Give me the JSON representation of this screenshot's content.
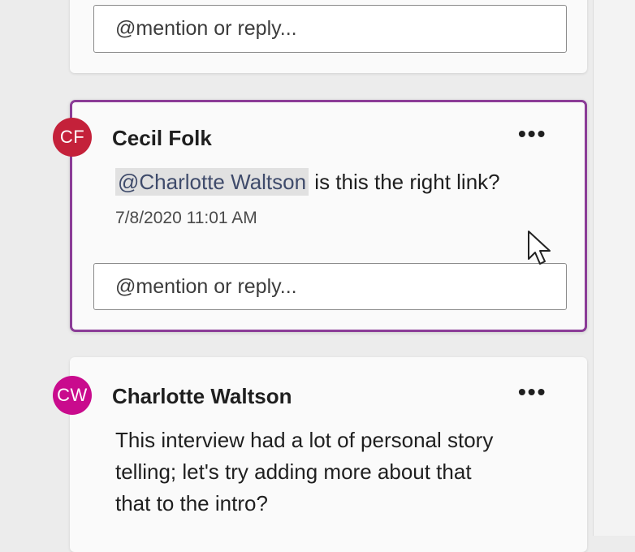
{
  "top_comment": {
    "reply_placeholder": "@mention or reply..."
  },
  "active_comment": {
    "avatar_initials": "CF",
    "avatar_color": "#c4213a",
    "author": "Cecil Folk",
    "more_label": "•••",
    "mention": "@Charlotte Waltson",
    "text": " is this the right link?",
    "timestamp": "7/8/2020 11:01 AM",
    "reply_placeholder": "@mention or reply...",
    "highlight_color": "#8b3c97"
  },
  "bottom_comment": {
    "avatar_initials": "CW",
    "avatar_color": "#c90b8d",
    "author": "Charlotte Waltson",
    "more_label": "•••",
    "text_line1": "This interview had a lot of personal story",
    "text_line2": "telling; let's try adding more about that",
    "text_line3": "that to the intro?"
  }
}
